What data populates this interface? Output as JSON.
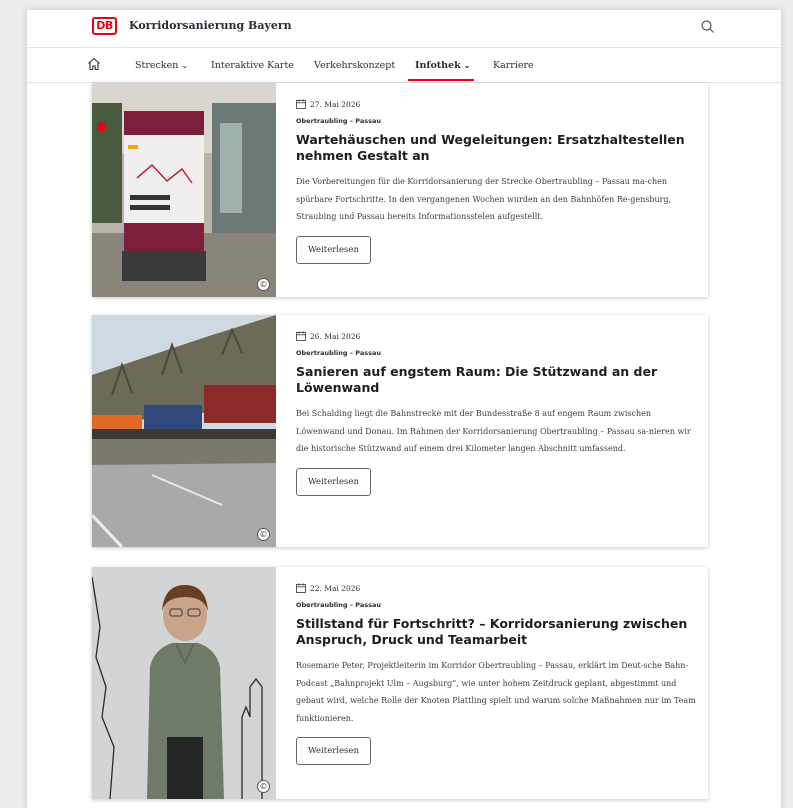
{
  "header": {
    "logo_text": "DB",
    "site_title": "Korridorsanierung Bayern",
    "brand_color": "#ec0016"
  },
  "nav": {
    "home_icon": "home-icon",
    "items": [
      {
        "label": "Strecken",
        "dropdown": true
      },
      {
        "label": "Interaktive Karte",
        "dropdown": false
      },
      {
        "label": "Verkehrskonzept",
        "dropdown": false
      },
      {
        "label": "Infothek",
        "dropdown": true,
        "active": true
      },
      {
        "label": "Karriere",
        "dropdown": false
      }
    ]
  },
  "articles": [
    {
      "date": "27. Mai 2026",
      "tag": "Obertraubling – Passau",
      "title": "Wartehäuschen und Wegeleitungen: Ersatzhaltestellen nehmen Gestalt an",
      "teaser": "Die Vorbereitungen für die Korridorsanierung der Strecke Obertraubling – Passau ma-chen spürbare Fortschritte. In den vergangenen Wochen wurden an den Bahnhöfen Re-gensburg, Straubing und Passau bereits Informationsstelen aufgestellt.",
      "button": "Weiterlesen",
      "copyright": "©"
    },
    {
      "date": "26. Mai 2026",
      "tag": "Obertraubling – Passau",
      "title": "Sanieren auf engstem Raum: Die Stützwand an der Löwenwand",
      "teaser": "Bei Schalding liegt die Bahnstrecke mit der Bundesstraße 8 auf engem Raum zwischen Löwenwand und Donau. Im Rahmen der Korridorsanierung Obertraubling – Passau sa-nieren wir die historische Stützwand auf einem drei Kilometer langen Abschnitt umfassend.",
      "button": "Weiterlesen",
      "copyright": "©"
    },
    {
      "date": "22. Mai 2026",
      "tag": "Obertraubling – Passau",
      "title": "Stillstand für Fortschritt? – Korridorsanierung zwischen Anspruch, Druck und Teamarbeit",
      "teaser": "Rosemarie Peter, Projektleiterin im Korridor Obertraubling – Passau, erklärt im Deut-sche Bahn-Podcast „Bahnprojekt Ulm – Augsburg“, wie unter hohem Zeitdruck geplant, abgestimmt und gebaut wird, welche Rolle der Knoten Plattling spielt und warum solche Maßnahmen nur im Team funktionieren.",
      "button": "Weiterlesen",
      "copyright": "©"
    }
  ]
}
